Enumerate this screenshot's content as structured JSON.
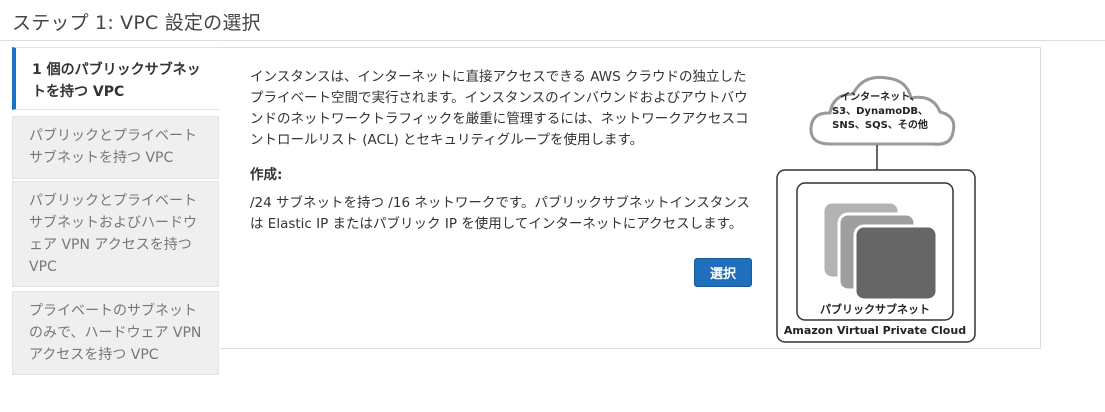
{
  "header": {
    "title": "ステップ 1: VPC 設定の選択"
  },
  "tabs": [
    {
      "label": "1 個のパブリックサブネットを持つ VPC",
      "active": true
    },
    {
      "label": "パブリックとプライベートサブネットを持つ VPC",
      "active": false
    },
    {
      "label": "パブリックとプライベートサブネットおよびハードウェア VPN アクセスを持つ VPC",
      "active": false
    },
    {
      "label": "プライベートのサブネットのみで、ハードウェア VPN アクセスを持つ VPC",
      "active": false
    }
  ],
  "content": {
    "description": "インスタンスは、インターネットに直接アクセスできる AWS クラウドの独立したプライベート空間で実行されます。インスタンスのインバウンドおよびアウトバウンドのネットワークトラフィックを厳重に管理するには、ネットワークアクセスコントロールリスト (ACL) とセキュリティグループを使用します。",
    "create_label": "作成:",
    "create_text": "/24 サブネットを持つ /16 ネットワークです。パブリックサブネットインスタンスは Elastic IP またはパブリック IP を使用してインターネットにアクセスします。",
    "select_button": "選択"
  },
  "diagram": {
    "cloud_line1": "インターネット、",
    "cloud_line2": "S3、DynamoDB、",
    "cloud_line3": "SNS、SQS、その他",
    "subnet_label": "パブリックサブネット",
    "vpc_label": "Amazon Virtual Private Cloud"
  },
  "colors": {
    "accent": "#1a73c7",
    "button": "#1f6fbd",
    "tab_inactive_bg": "#efefef",
    "server_dark": "#666666",
    "server_light": "#b3b3b3"
  }
}
